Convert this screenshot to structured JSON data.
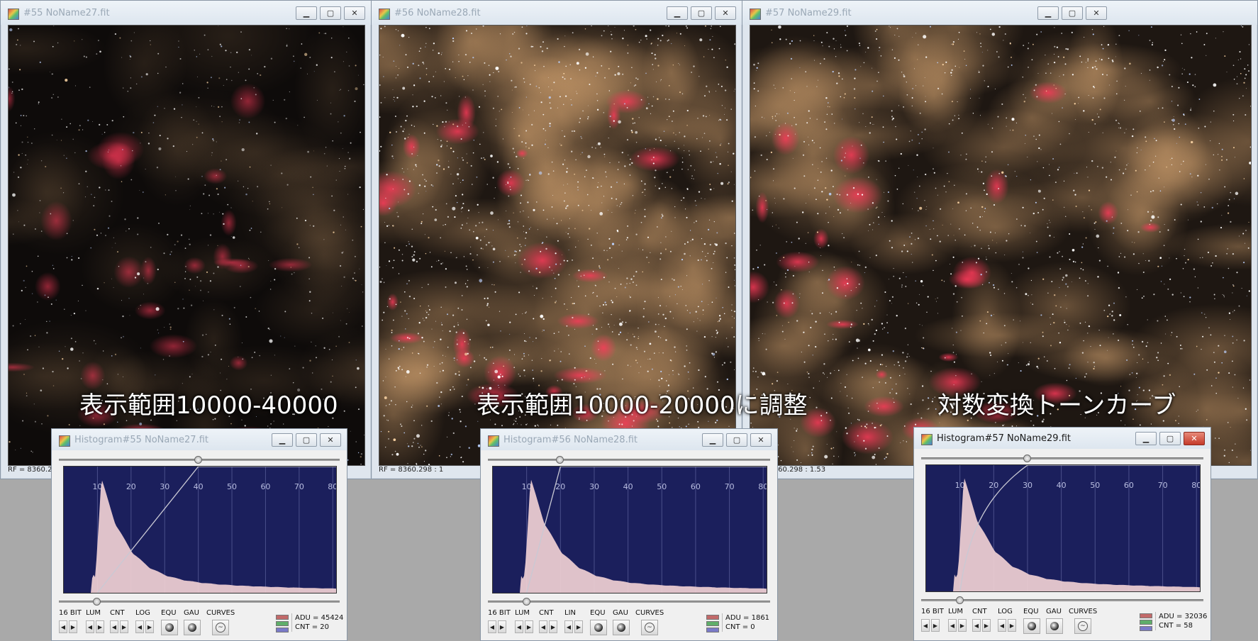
{
  "windows": [
    {
      "title": "#55 NoName27.fit",
      "status": "RF = 8360.29"
    },
    {
      "title": "#56 NoName28.fit",
      "status": "RF = 8360.298 : 1"
    },
    {
      "title": "#57 NoName29.fit",
      "status": "RF = 8360.298 : 1.53"
    }
  ],
  "captions": [
    "表示範囲10000-40000",
    "表示範囲10000-20000に調整",
    "対数変換トーンカーブ"
  ],
  "histograms": [
    {
      "title": "Histogram#55 NoName27.fit",
      "scale_mode": "LOG",
      "adu": "ADU = 45424",
      "cnt": "CNT = 20",
      "active": false,
      "curve": "linear",
      "hi": 40
    },
    {
      "title": "Histogram#56 NoName28.fit",
      "scale_mode": "LIN",
      "adu": "ADU = 1861",
      "cnt": "CNT = 0",
      "active": false,
      "curve": "linear",
      "hi": 20
    },
    {
      "title": "Histogram#57 NoName29.fit",
      "scale_mode": "LOG",
      "adu": "ADU = 32036",
      "cnt": "CNT = 58",
      "active": true,
      "curve": "log",
      "hi": 30
    }
  ],
  "hist_axis": {
    "ticks": [
      "10",
      "20",
      "30",
      "40",
      "50",
      "60",
      "70",
      "80"
    ],
    "min": 0,
    "max": 81,
    "low": 10
  },
  "controls": {
    "bit": "16 BIT",
    "lum": "LUM",
    "cnt": "CNT",
    "equ": "EQU",
    "gau": "GAU",
    "curves": "CURVES"
  },
  "window_buttons": {
    "minimize": "▁",
    "maximize": "▢",
    "close": "✕"
  },
  "colors": {
    "plot_bg": "#1b1f5c",
    "hist_fill": "#f0d0d4",
    "curve": "#c9c9d4",
    "grid": "#4a4f8a"
  }
}
